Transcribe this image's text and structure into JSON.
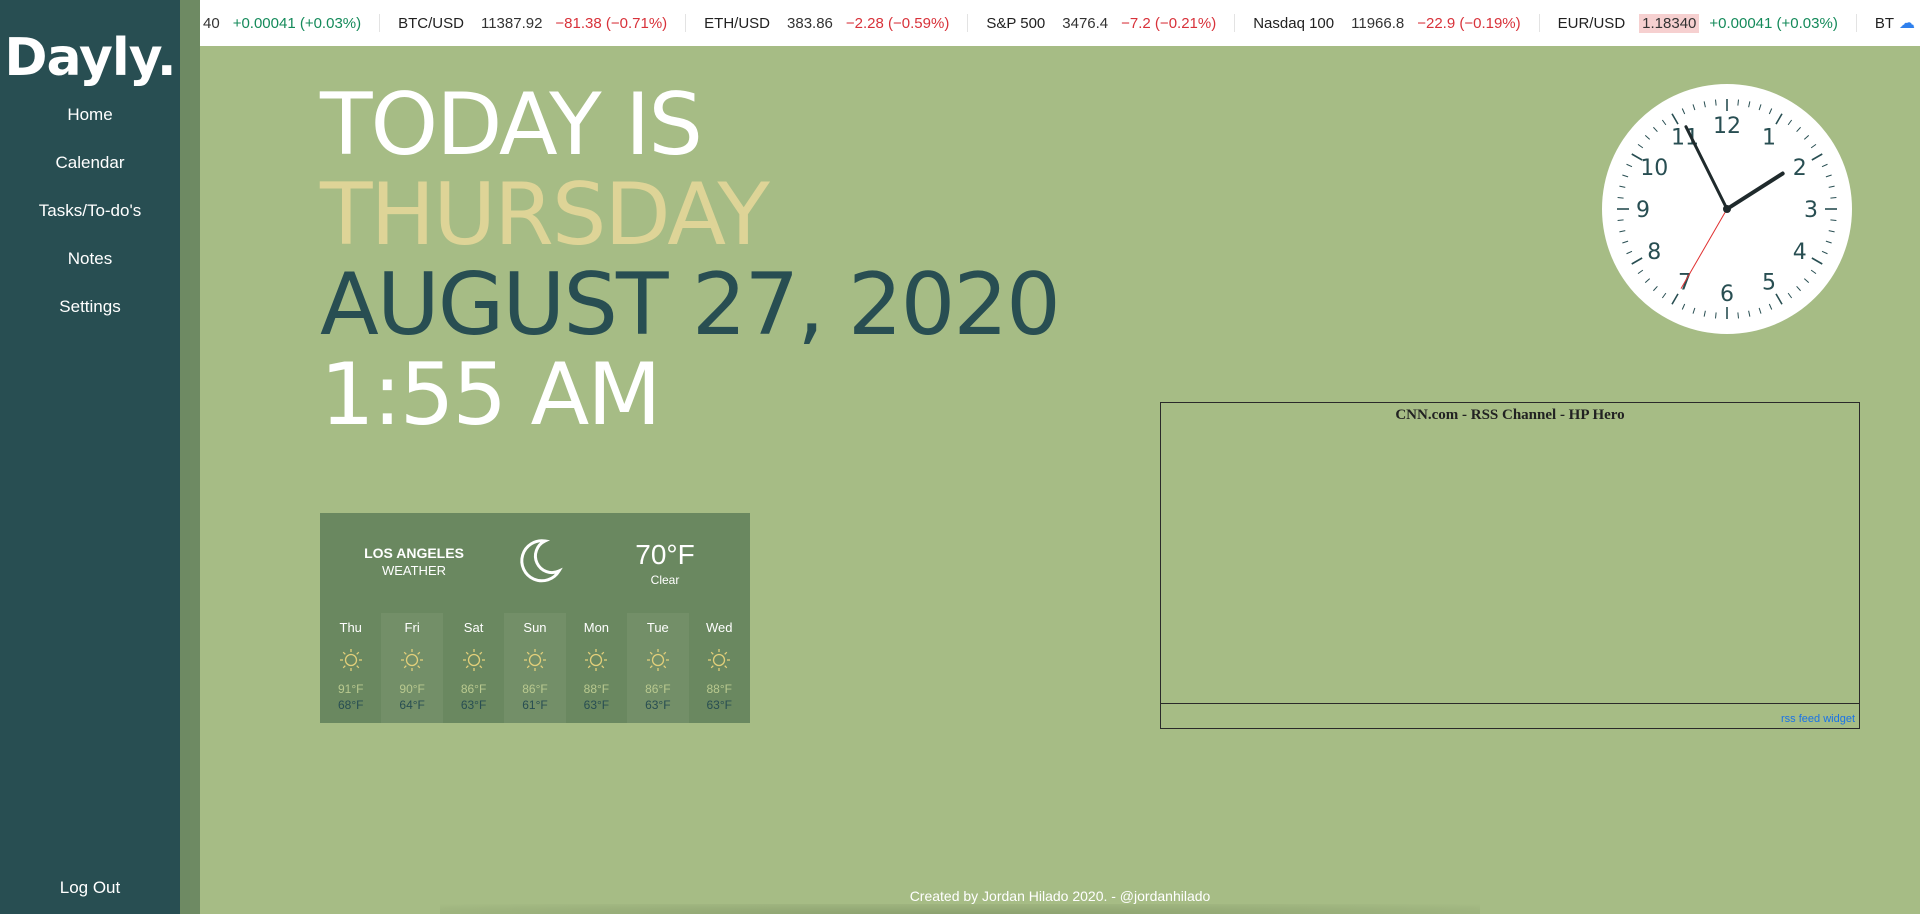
{
  "app": {
    "logo": "Dayly.",
    "nav": [
      {
        "label": "Home"
      },
      {
        "label": "Calendar"
      },
      {
        "label": "Tasks/To-do's"
      },
      {
        "label": "Notes"
      },
      {
        "label": "Settings"
      }
    ],
    "logout": "Log Out"
  },
  "ticker": {
    "items": [
      {
        "symbol": "",
        "price": "40",
        "change": "+0.00041 (+0.03%)",
        "direction": "up",
        "highlight": false
      },
      {
        "symbol": "BTC/USD",
        "price": "11387.92",
        "change": "−81.38 (−0.71%)",
        "direction": "down",
        "highlight": false
      },
      {
        "symbol": "ETH/USD",
        "price": "383.86",
        "change": "−2.28 (−0.59%)",
        "direction": "down",
        "highlight": false
      },
      {
        "symbol": "S&P 500",
        "price": "3476.4",
        "change": "−7.2 (−0.21%)",
        "direction": "down",
        "highlight": false
      },
      {
        "symbol": "Nasdaq 100",
        "price": "11966.8",
        "change": "−22.9 (−0.19%)",
        "direction": "down",
        "highlight": false
      },
      {
        "symbol": "EUR/USD",
        "price": "1.18340",
        "change": "+0.00041 (+0.03%)",
        "direction": "up",
        "highlight": true
      },
      {
        "symbol": "BTC",
        "price": "",
        "change": "",
        "direction": "",
        "highlight": false
      }
    ],
    "colors": {
      "up": "#148a5a",
      "down": "#d8323a"
    }
  },
  "date": {
    "line1": "TODAY IS",
    "line2": "THURSDAY",
    "line3": "AUGUST 27, 2020",
    "line4": "1:55 AM"
  },
  "clock": {
    "numbers": [
      "12",
      "1",
      "2",
      "3",
      "4",
      "5",
      "6",
      "7",
      "8",
      "9",
      "10",
      "11"
    ],
    "hour": 1,
    "minute": 55,
    "second": 35
  },
  "weather": {
    "city": "LOS ANGELES",
    "subtitle": "WEATHER",
    "current_icon": "moon-icon",
    "temp": "70°F",
    "condition": "Clear",
    "days": [
      {
        "name": "Thu",
        "icon": "sun-icon",
        "high": "91°F",
        "low": "68°F"
      },
      {
        "name": "Fri",
        "icon": "sun-icon",
        "high": "90°F",
        "low": "64°F"
      },
      {
        "name": "Sat",
        "icon": "sun-icon",
        "high": "86°F",
        "low": "63°F"
      },
      {
        "name": "Sun",
        "icon": "sun-icon",
        "high": "86°F",
        "low": "61°F"
      },
      {
        "name": "Mon",
        "icon": "sun-icon",
        "high": "88°F",
        "low": "63°F"
      },
      {
        "name": "Tue",
        "icon": "sun-icon",
        "high": "86°F",
        "low": "63°F"
      },
      {
        "name": "Wed",
        "icon": "sun-icon",
        "high": "88°F",
        "low": "63°F"
      }
    ]
  },
  "rss": {
    "title": "CNN.com - RSS Channel - HP Hero",
    "link": "rss feed widget"
  },
  "footer": {
    "text": "Created by Jordan Hilado 2020. - @jordanhilado"
  },
  "colors": {
    "background": "#a6bc85",
    "sidebar": "#284e52",
    "accent_day": "#ded497",
    "date_dark": "#284e52",
    "weather_panel": "#6a8860"
  }
}
